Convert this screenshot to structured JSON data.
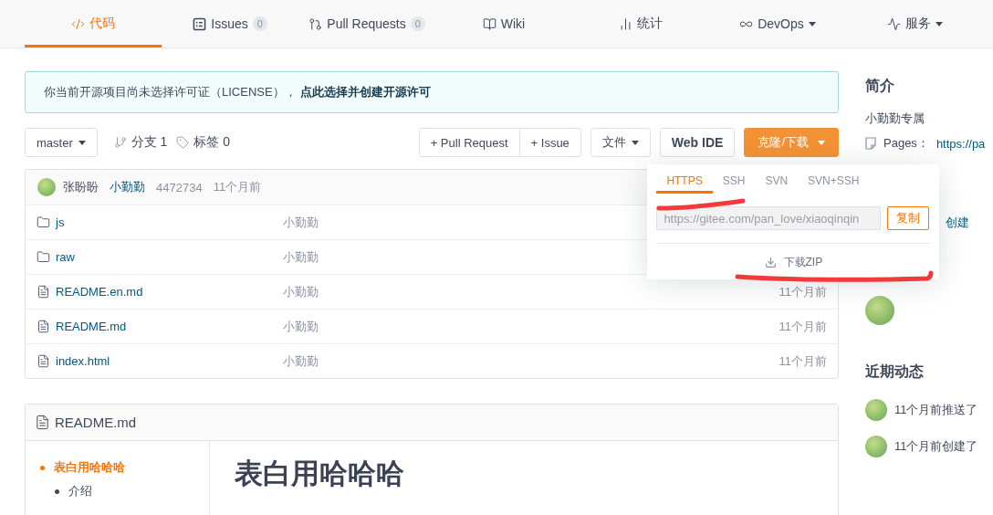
{
  "nav_tabs": [
    {
      "label": "代码",
      "selected": true,
      "dropdown": false
    },
    {
      "label": "Issues",
      "count": "0",
      "selected": false,
      "dropdown": false
    },
    {
      "label": "Pull Requests",
      "count": "0",
      "selected": false,
      "dropdown": false
    },
    {
      "label": "Wiki",
      "selected": false,
      "dropdown": false
    },
    {
      "label": "统计",
      "selected": false,
      "dropdown": false
    },
    {
      "label": "DevOps",
      "selected": false,
      "dropdown": true
    },
    {
      "label": "服务",
      "selected": false,
      "dropdown": true
    }
  ],
  "license_notice": {
    "text": "你当前开源项目尚未选择许可证（LICENSE），",
    "link": "点此选择并创建开源许可"
  },
  "repo_bar": {
    "branch": "master",
    "branches": "分支 1",
    "tags": "标签 0",
    "pull_request": "+ Pull Request",
    "issue": "+ Issue",
    "files": "文件",
    "web_ide": "Web IDE",
    "clone": "克隆/下载"
  },
  "clone_popup": {
    "tabs": [
      {
        "label": "HTTPS",
        "selected": true
      },
      {
        "label": "SSH",
        "selected": false
      },
      {
        "label": "SVN",
        "selected": false
      },
      {
        "label": "SVN+SSH",
        "selected": false
      }
    ],
    "url": "https://gitee.com/pan_love/xiaoqinqin",
    "copy": "复制",
    "download": "下载ZIP"
  },
  "latest_commit": {
    "author": "张盼盼",
    "message": "小勤勤",
    "hash": "4472734",
    "time": "11个月前"
  },
  "files": [
    {
      "kind": "folder",
      "name": "js",
      "message": "小勤勤"
    },
    {
      "kind": "folder",
      "name": "raw",
      "message": "小勤勤"
    },
    {
      "kind": "file",
      "name": "README.en.md",
      "message": "小勤勤",
      "time": "11个月前"
    },
    {
      "kind": "file",
      "name": "README.md",
      "message": "小勤勤",
      "time": "11个月前"
    },
    {
      "kind": "file",
      "name": "index.html",
      "message": "小勤勤",
      "time": "11个月前"
    }
  ],
  "readme": {
    "title": "README.md",
    "toc": [
      {
        "label": "表白用哈哈哈",
        "selected": true,
        "children": [
          {
            "label": "介绍",
            "selected": false
          }
        ]
      }
    ],
    "heading": "表白用哈哈哈"
  },
  "sidebar": {
    "intro_title": "简介",
    "description": "小勤勤专属",
    "pages_label": "Pages：",
    "pages_url": "https://pa",
    "text_fragment": "创建",
    "activity_title": "近期动态",
    "activities": [
      {
        "text": "11个月前推送了"
      },
      {
        "text": "11个月前创建了"
      }
    ]
  }
}
